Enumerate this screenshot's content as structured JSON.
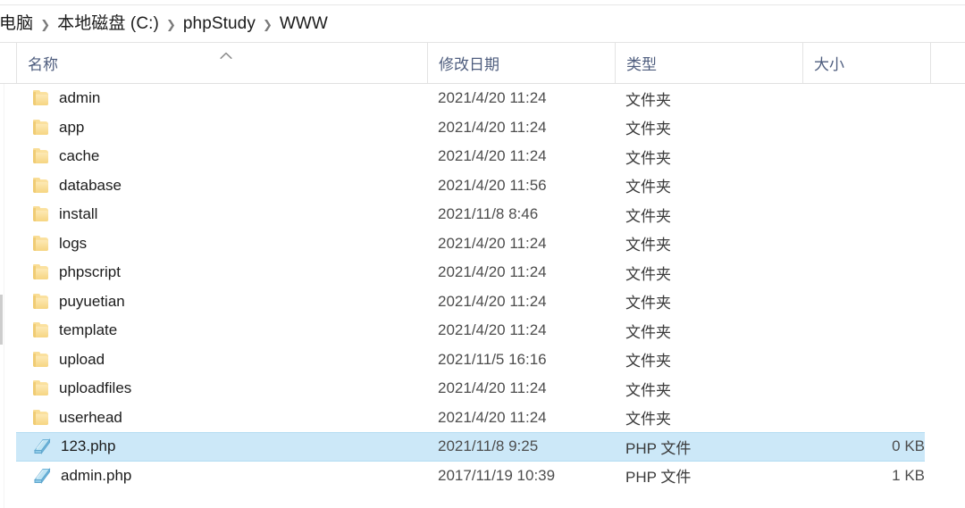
{
  "window": {
    "title": "WWW"
  },
  "breadcrumb": {
    "name": "address-breadcrumb",
    "separator": "❯",
    "items": [
      {
        "label": "电脑"
      },
      {
        "label": "本地磁盘 (C:)"
      },
      {
        "label": "phpStudy"
      },
      {
        "label": "WWW"
      }
    ]
  },
  "columns": {
    "name": "名称",
    "date_modified": "修改日期",
    "type": "类型",
    "size": "大小",
    "sort": {
      "column": "名称",
      "direction": "ascending",
      "glyph": "ⱏ"
    }
  },
  "types": {
    "folder": "文件夹",
    "php": "PHP 文件"
  },
  "colors": {
    "selection_fill": "#cce8f8",
    "selection_border": "#b4ddf2",
    "header_text": "#4e5d7e",
    "folder_icon": "#f8d98c",
    "php_icon": "#7fc4e8"
  },
  "files": [
    {
      "name": "admin",
      "date": "2021/4/20 11:24",
      "type": "文件夹",
      "size": "",
      "icon": "folder-icon",
      "selected": false
    },
    {
      "name": "app",
      "date": "2021/4/20 11:24",
      "type": "文件夹",
      "size": "",
      "icon": "folder-icon",
      "selected": false
    },
    {
      "name": "cache",
      "date": "2021/4/20 11:24",
      "type": "文件夹",
      "size": "",
      "icon": "folder-icon",
      "selected": false
    },
    {
      "name": "database",
      "date": "2021/4/20 11:56",
      "type": "文件夹",
      "size": "",
      "icon": "folder-icon",
      "selected": false
    },
    {
      "name": "install",
      "date": "2021/11/8 8:46",
      "type": "文件夹",
      "size": "",
      "icon": "folder-icon",
      "selected": false
    },
    {
      "name": "logs",
      "date": "2021/4/20 11:24",
      "type": "文件夹",
      "size": "",
      "icon": "folder-icon",
      "selected": false
    },
    {
      "name": "phpscript",
      "date": "2021/4/20 11:24",
      "type": "文件夹",
      "size": "",
      "icon": "folder-icon",
      "selected": false
    },
    {
      "name": "puyuetian",
      "date": "2021/4/20 11:24",
      "type": "文件夹",
      "size": "",
      "icon": "folder-icon",
      "selected": false
    },
    {
      "name": "template",
      "date": "2021/4/20 11:24",
      "type": "文件夹",
      "size": "",
      "icon": "folder-icon",
      "selected": false
    },
    {
      "name": "upload",
      "date": "2021/11/5 16:16",
      "type": "文件夹",
      "size": "",
      "icon": "folder-icon",
      "selected": false
    },
    {
      "name": "uploadfiles",
      "date": "2021/4/20 11:24",
      "type": "文件夹",
      "size": "",
      "icon": "folder-icon",
      "selected": false
    },
    {
      "name": "userhead",
      "date": "2021/4/20 11:24",
      "type": "文件夹",
      "size": "",
      "icon": "folder-icon",
      "selected": false
    },
    {
      "name": "123.php",
      "date": "2021/11/8 9:25",
      "type": "PHP 文件",
      "size": "0 KB",
      "icon": "php-file-icon",
      "selected": true
    },
    {
      "name": "admin.php",
      "date": "2017/11/19 10:39",
      "type": "PHP 文件",
      "size": "1 KB",
      "icon": "php-file-icon",
      "selected": false
    }
  ]
}
